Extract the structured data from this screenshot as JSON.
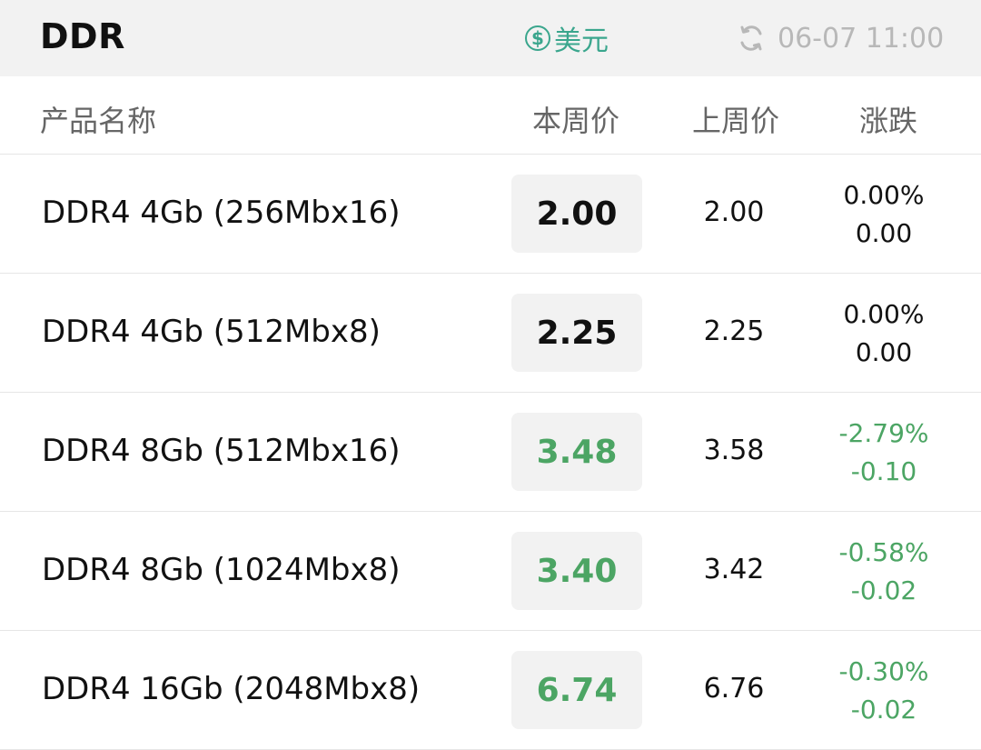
{
  "header": {
    "title": "DDR",
    "currency_label": "美元",
    "currency_icon": "dollar-icon",
    "refresh_icon": "refresh-icon",
    "timestamp": "06-07 11:00"
  },
  "columns": {
    "name": "产品名称",
    "this_week": "本周价",
    "last_week": "上周价",
    "change": "涨跌"
  },
  "colors": {
    "neutral": "#111111",
    "down": "#4ca564",
    "accent": "#3aa68d"
  },
  "rows": [
    {
      "name": "DDR4 4Gb (256Mbx16)",
      "this_week": "2.00",
      "last_week": "2.00",
      "change_pct": "0.00%",
      "change_abs": "0.00",
      "trend": "neutral"
    },
    {
      "name": "DDR4 4Gb (512Mbx8)",
      "this_week": "2.25",
      "last_week": "2.25",
      "change_pct": "0.00%",
      "change_abs": "0.00",
      "trend": "neutral"
    },
    {
      "name": "DDR4 8Gb (512Mbx16)",
      "this_week": "3.48",
      "last_week": "3.58",
      "change_pct": "-2.79%",
      "change_abs": "-0.10",
      "trend": "down"
    },
    {
      "name": "DDR4 8Gb (1024Mbx8)",
      "this_week": "3.40",
      "last_week": "3.42",
      "change_pct": "-0.58%",
      "change_abs": "-0.02",
      "trend": "down"
    },
    {
      "name": "DDR4 16Gb (2048Mbx8)",
      "this_week": "6.74",
      "last_week": "6.76",
      "change_pct": "-0.30%",
      "change_abs": "-0.02",
      "trend": "down"
    }
  ]
}
